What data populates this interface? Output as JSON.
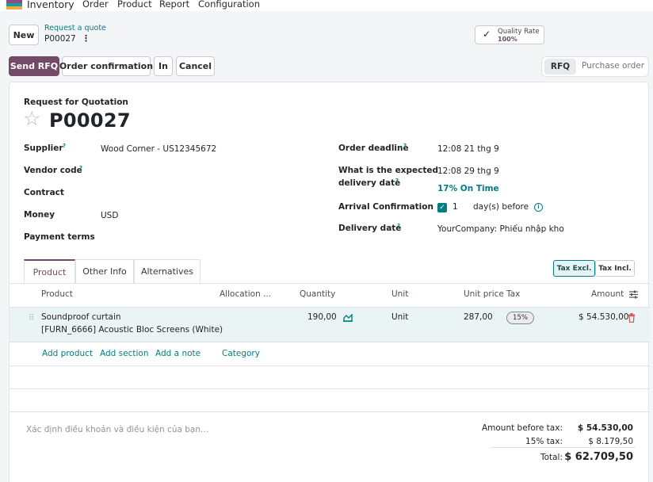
{
  "nav": {
    "app_name": "Inventory",
    "menu": [
      "Order",
      "Product",
      "Report",
      "Configuration"
    ]
  },
  "control": {
    "new_label": "New",
    "breadcrumb_parent": "Request a quote",
    "breadcrumb_current": "P00027",
    "gear": "⋮",
    "quality_label": "Quality Rate",
    "quality_value": "100%"
  },
  "actions": {
    "send_rfq": "Send RFQ",
    "order_confirmation": "Order confirmation",
    "print": "In",
    "cancel": "Cancel"
  },
  "statusbar": {
    "current": "RFQ",
    "next": "Purchase order"
  },
  "form": {
    "title": "Request for Quotation",
    "name": "P00027",
    "left_fields": {
      "supplier_label": "Supplier",
      "supplier_value": "Wood Corner - US12345672",
      "vendor_code_label": "Vendor code",
      "contract_label": "Contract",
      "money_label": "Money",
      "money_value": "USD",
      "payment_terms_label": "Payment terms"
    },
    "right_fields": {
      "order_deadline_label": "Order deadline",
      "order_deadline_value": "12:08 21 thg 9",
      "expected_label_1": "What is the expected",
      "expected_label_2": "delivery date",
      "expected_value": "12:08 29 thg 9",
      "on_time": "17% On Time",
      "arrival_label": "Arrival Confirmation",
      "arrival_days": "1",
      "arrival_suffix": "day(s) before",
      "delivery_label": "Delivery date",
      "delivery_value": "YourCompany: Phiếu nhập kho"
    },
    "help_mark": "?"
  },
  "tabs": [
    "Product",
    "Other Info",
    "Alternatives"
  ],
  "tax_toggle": {
    "excl": "Tax Excl.",
    "incl": "Tax Incl."
  },
  "table": {
    "headers": {
      "product": "Product",
      "allocation": "Allocation ...",
      "quantity": "Quantity",
      "unit": "Unit",
      "unit_price": "Unit price",
      "tax": "Tax",
      "amount": "Amount"
    },
    "rows": [
      {
        "product_line1": "Soundproof curtain",
        "product_line2": "[FURN_6666] Acoustic Bloc Screens (White)",
        "quantity": "190,00",
        "unit": "Unit",
        "unit_price": "287,00",
        "tax": "15%",
        "amount": "$ 54.530,00"
      }
    ],
    "add_links": {
      "product": "Add product",
      "section": "Add section",
      "note": "Add a note",
      "category": "Category"
    }
  },
  "footer": {
    "terms_placeholder": "Xác định điều khoản và điều kiện của bạn...",
    "before_tax_label": "Amount before tax:",
    "before_tax_value": "$ 54.530,00",
    "tax_label": "15% tax:",
    "tax_value": "$ 8.179,50",
    "total_label": "Total:",
    "total_value": "$ 62.709,50"
  },
  "colors": {
    "brand": "#714b67",
    "accent": "#017e84"
  }
}
